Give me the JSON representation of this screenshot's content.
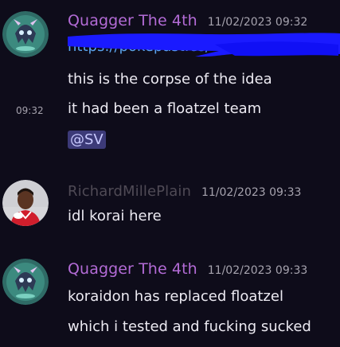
{
  "messages": [
    {
      "author": "Quagger The 4th",
      "timestamp": "11/02/2023 09:32",
      "link_text": "https://pokepast.es/",
      "lines": [
        "this is the corpse of the idea",
        "it had been a floatzel team"
      ],
      "hover_time": "09:32",
      "mention": "@SV"
    },
    {
      "author": "RichardMillePlain",
      "timestamp": "11/02/2023 09:33",
      "lines": [
        "idl korai here"
      ]
    },
    {
      "author": "Quagger The 4th",
      "timestamp": "11/02/2023 09:33",
      "lines": [
        "koraidon has replaced floatzel",
        "which i tested and fucking sucked"
      ]
    }
  ],
  "colors": {
    "background": "#0e0c1a",
    "author_purple": "#b36bd6",
    "author_gray": "#4f4a55",
    "link": "#5aa3ec",
    "redaction": "#1a1aff",
    "mention_bg": "#3c3a78"
  },
  "icons": {
    "avatar_1": "ghost-pokemon-avatar-icon",
    "avatar_2": "football-player-avatar-icon",
    "avatar_3": "ghost-pokemon-avatar-icon"
  }
}
